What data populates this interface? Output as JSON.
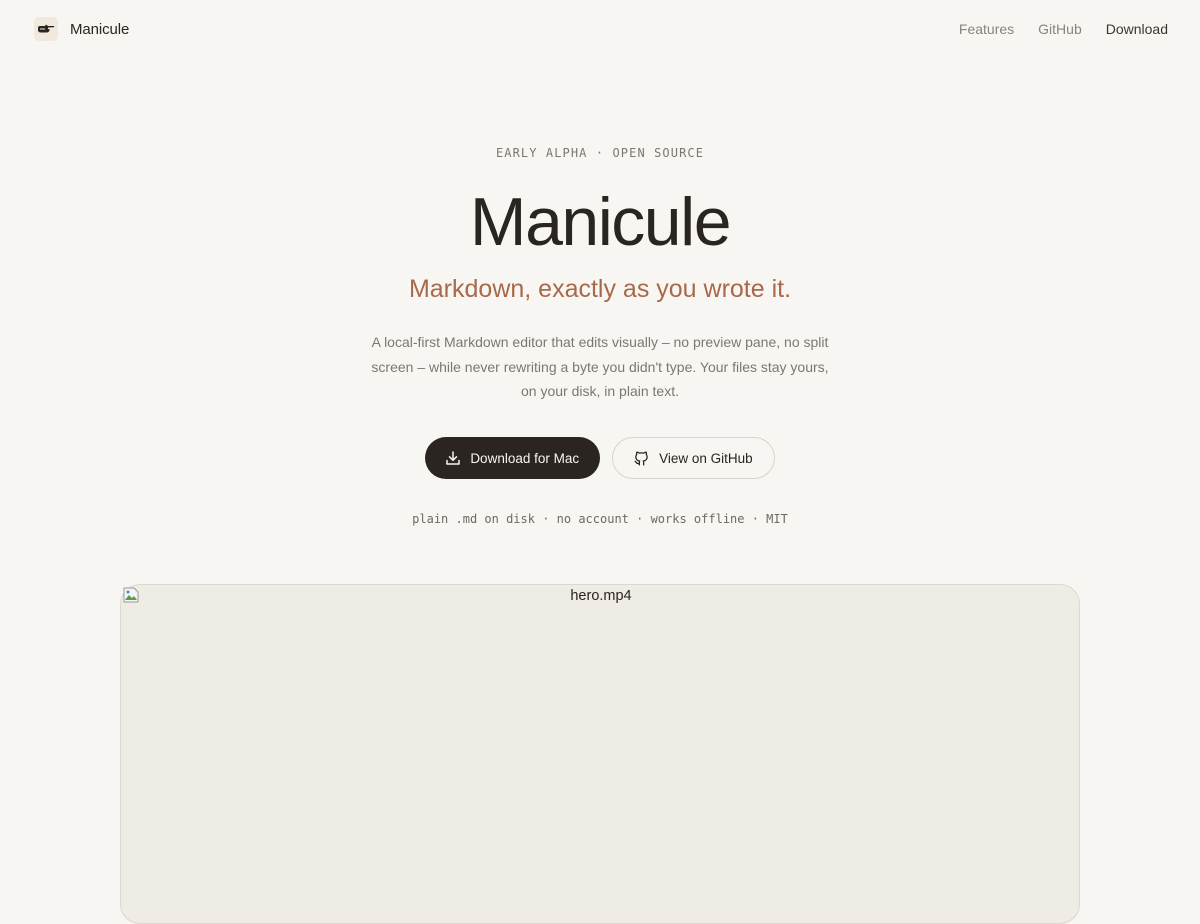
{
  "brand": {
    "name": "Manicule",
    "logo_icon": "pointing-hand-icon"
  },
  "nav": {
    "items": [
      {
        "label": "Features"
      },
      {
        "label": "GitHub"
      },
      {
        "label": "Download"
      }
    ]
  },
  "hero": {
    "eyebrow": "EARLY ALPHA · OPEN SOURCE",
    "title": "Manicule",
    "tagline": "Markdown, exactly as you wrote it.",
    "description": "A local-first Markdown editor that edits visually – no preview pane, no split screen – while never rewriting a byte you didn't type. Your files stay yours, on your disk, in plain text.",
    "primary_button": {
      "label": "Download for Mac",
      "icon": "download-icon"
    },
    "secondary_button": {
      "label": "View on GitHub",
      "icon": "github-icon"
    },
    "facts": "plain .md on disk · no account · works offline · MIT"
  },
  "media": {
    "alt_text": "hero.mp4",
    "icon": "broken-image-icon"
  },
  "colors": {
    "background": "#f8f6f2",
    "text": "#2a2521",
    "accent": "#a8694a",
    "muted": "#7d7771",
    "button_dark": "#2a2521"
  }
}
